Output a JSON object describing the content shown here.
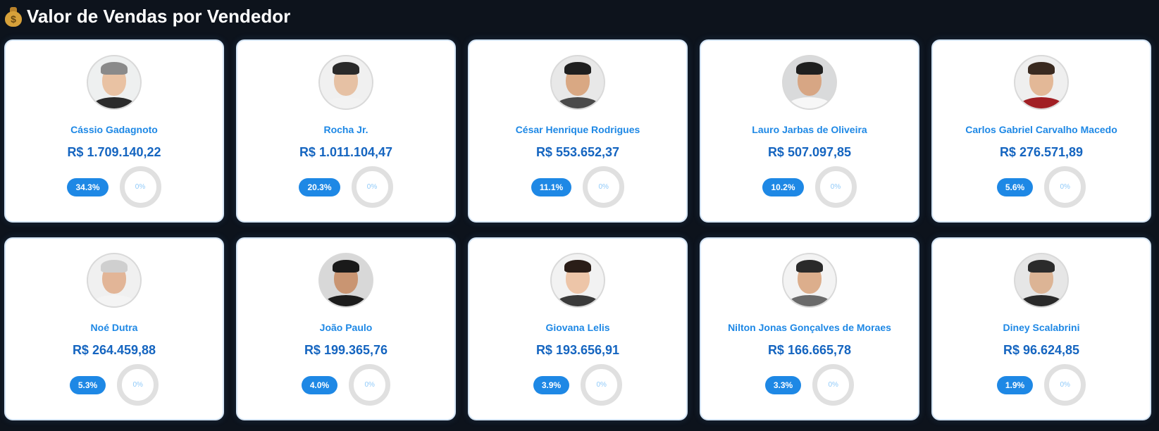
{
  "header": {
    "icon": "money-bag-icon",
    "title": "Valor de Vendas por Vendedor"
  },
  "sellers": [
    {
      "name": "Cássio Gadagnoto",
      "value": "R$ 1.709.140,22",
      "share": "34.3%",
      "goal": "0%",
      "skin": "#e9c2a3",
      "hair": "#8a8a8a",
      "shirt": "#2b2b2b",
      "bg": "#eef0f0"
    },
    {
      "name": "Rocha Jr.",
      "value": "R$ 1.011.104,47",
      "share": "20.3%",
      "goal": "0%",
      "skin": "#e6c1a4",
      "hair": "#2a2a2a",
      "shirt": "#f2f2f2",
      "bg": "#f0f0f0"
    },
    {
      "name": "César Henrique Rodrigues",
      "value": "R$ 553.652,37",
      "share": "11.1%",
      "goal": "0%",
      "skin": "#d9a883",
      "hair": "#1f1f1f",
      "shirt": "#4a4a4a",
      "bg": "#e8e8e8"
    },
    {
      "name": "Lauro Jarbas de Oliveira",
      "value": "R$ 507.097,85",
      "share": "10.2%",
      "goal": "0%",
      "skin": "#d7a684",
      "hair": "#1f1f1f",
      "shirt": "#f7f7f7",
      "bg": "#d9dadb"
    },
    {
      "name": "Carlos Gabriel Carvalho Macedo",
      "value": "R$ 276.571,89",
      "share": "5.6%",
      "goal": "0%",
      "skin": "#e3b897",
      "hair": "#3a2a20",
      "shirt": "#a11f24",
      "bg": "#efefef"
    },
    {
      "name": "Noé Dutra",
      "value": "R$ 264.459,88",
      "share": "5.3%",
      "goal": "0%",
      "skin": "#e2b597",
      "hair": "#cfcfcf",
      "shirt": "#f4f4f4",
      "bg": "#f0f0f0"
    },
    {
      "name": "João Paulo",
      "value": "R$ 199.365,76",
      "share": "4.0%",
      "goal": "0%",
      "skin": "#c99572",
      "hair": "#1a1a1a",
      "shirt": "#1c1c1c",
      "bg": "#d8d8d8"
    },
    {
      "name": "Giovana Lelis",
      "value": "R$ 193.656,91",
      "share": "3.9%",
      "goal": "0%",
      "skin": "#edc5a8",
      "hair": "#2a1d17",
      "shirt": "#3a3a3a",
      "bg": "#f2f2f2"
    },
    {
      "name": "Nilton Jonas Gonçalves de Moraes",
      "value": "R$ 166.665,78",
      "share": "3.3%",
      "goal": "0%",
      "skin": "#dcae8c",
      "hair": "#2a2a2a",
      "shirt": "#6a6a6a",
      "bg": "#f3f3f3"
    },
    {
      "name": "Diney Scalabrini",
      "value": "R$ 96.624,85",
      "share": "1.9%",
      "goal": "0%",
      "skin": "#dcb495",
      "hair": "#2b2b2b",
      "shirt": "#2a2a2a",
      "bg": "#e6e6e6"
    }
  ]
}
